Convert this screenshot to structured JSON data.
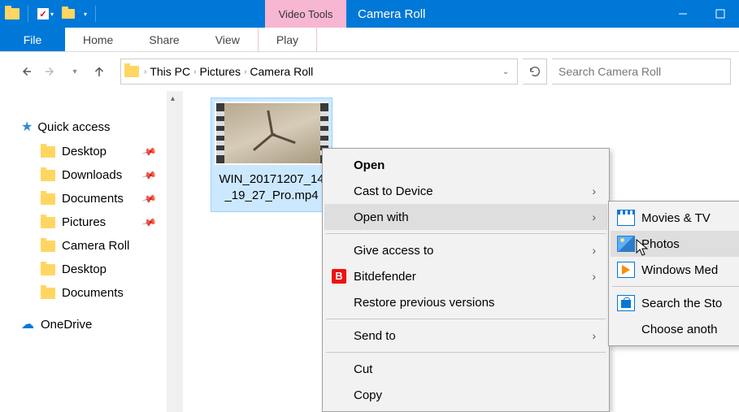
{
  "titlebar": {
    "tool_tab": "Video Tools",
    "window_title": "Camera Roll"
  },
  "ribbon": {
    "file": "File",
    "tabs": [
      "Home",
      "Share",
      "View",
      "Play"
    ]
  },
  "breadcrumb": {
    "items": [
      "This PC",
      "Pictures",
      "Camera Roll"
    ]
  },
  "search": {
    "placeholder": "Search Camera Roll"
  },
  "sidebar": {
    "quick_access": "Quick access",
    "items": [
      {
        "label": "Desktop",
        "pinned": true
      },
      {
        "label": "Downloads",
        "pinned": true
      },
      {
        "label": "Documents",
        "pinned": true
      },
      {
        "label": "Pictures",
        "pinned": true
      },
      {
        "label": "Camera Roll",
        "pinned": false
      },
      {
        "label": "Desktop",
        "pinned": false
      },
      {
        "label": "Documents",
        "pinned": false
      }
    ],
    "onedrive": "OneDrive"
  },
  "file": {
    "name": "WIN_20171207_14_19_27_Pro.mp4"
  },
  "context_menu": {
    "open": "Open",
    "cast": "Cast to Device",
    "open_with": "Open with",
    "give_access": "Give access to",
    "bitdefender": "Bitdefender",
    "restore": "Restore previous versions",
    "send_to": "Send to",
    "cut": "Cut",
    "copy": "Copy"
  },
  "submenu": {
    "movies": "Movies & TV",
    "photos": "Photos",
    "wmp": "Windows Med",
    "store": "Search the Sto",
    "choose": "Choose anoth"
  }
}
